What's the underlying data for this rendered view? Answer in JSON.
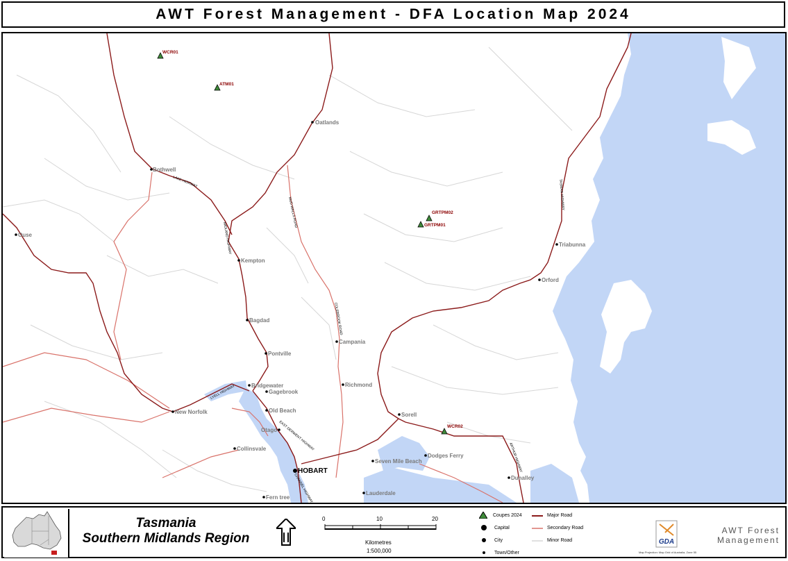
{
  "title": "AWT Forest Management - DFA Location Map 2024",
  "map": {
    "coupes": [
      {
        "id": "WCR01"
      },
      {
        "id": "ATM01"
      },
      {
        "id": "GRTPM02"
      },
      {
        "id": "GRTPM01"
      },
      {
        "id": "WCR02"
      }
    ],
    "towns": [
      "Oatlands",
      "Bothwell",
      "Ouse",
      "Kempton",
      "Bagdad",
      "Pontville",
      "Campania",
      "Richmond",
      "Bridgewater",
      "Gagebrook",
      "Old Beach",
      "New Norfolk",
      "Otago",
      "Collinsvale",
      "Sorell",
      "Dodges Ferry",
      "Seven Mile Beach",
      "Lauderdale",
      "Fern tree",
      "Dunalley",
      "Triabunna",
      "Orford"
    ],
    "capital": "HOBART",
    "road_labels": [
      "LAKE HIGHWAY",
      "MIDLAND HIGHWAY",
      "MUD WALLS ROAD",
      "COLEBROOK ROAD",
      "TASMAN HIGHWAY",
      "LYELL HIGHWAY",
      "EAST DERWENT HIGHWAY",
      "ARTHUR HIGHWAY",
      "CHANNEL HIGHWAY"
    ],
    "colors": {
      "water": "#c2d6f6",
      "major_road": "#8b1a1a",
      "secondary_road": "#d9726a",
      "minor_road": "#d6d6d6",
      "coupe_fill": "#3f8b3a",
      "coupe_label": "#8b0000",
      "town_label": "#7a7a7a"
    }
  },
  "legend": {
    "region_title_1": "Tasmania",
    "region_title_2": "Southern Midlands Region",
    "scale_ticks": [
      "0",
      "10",
      "20"
    ],
    "scale_unit": "Kilometres",
    "scale_ratio": "1:500,000",
    "items": {
      "coupes": "Coupes 2024",
      "capital": "Capital",
      "city": "City",
      "town": "Town/Other",
      "major": "Major Road",
      "secondary": "Secondary Road",
      "minor": "Minor Road"
    },
    "gda_text": "GDA",
    "projection_note": "Map Projection: Map Grid of Australia, Zone 55",
    "org_line1": "AWT Forest",
    "org_line2": "Management"
  }
}
